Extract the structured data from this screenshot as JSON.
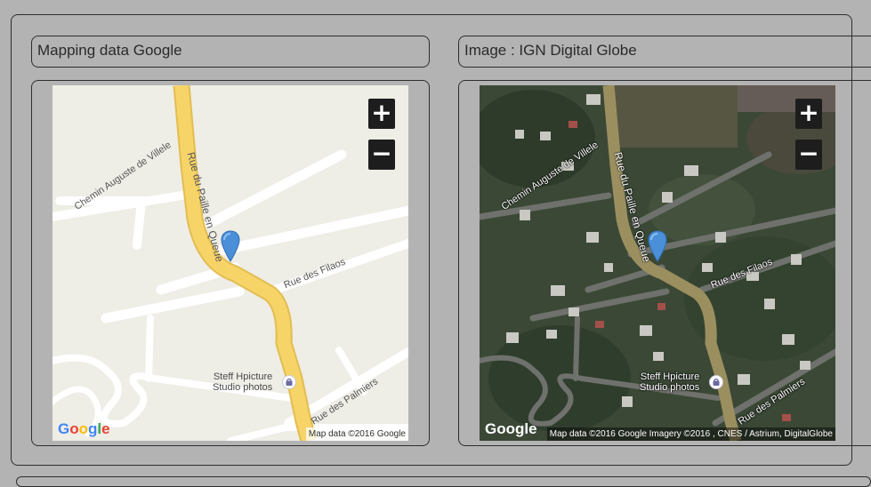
{
  "panels": {
    "left": {
      "title": "Mapping data Google",
      "zoom_in": "+",
      "zoom_out": "−",
      "logo": "Google",
      "credit": "Map data ©2016 Google",
      "tile_style": "roadmap",
      "labels": {
        "road_main": "Rue du Paille en Queue",
        "road_villele": "Chemin Auguste de Villele",
        "road_filaos": "Rue des Filaos",
        "road_palmiers": "Rue des Palmiers",
        "poi_line1": "Steff Hpicture",
        "poi_line2": "Studio photos"
      }
    },
    "right": {
      "title": "Image : IGN Digital Globe",
      "zoom_in": "+",
      "zoom_out": "−",
      "logo": "Google",
      "credit": "Map data ©2016 Google  Imagery ©2016 , CNES / Astrium, DigitalGlobe",
      "tile_style": "satellite",
      "labels": {
        "road_main": "Rue du Paille en Queue",
        "road_villele": "Chemin Auguste de Villele",
        "road_filaos": "Rue des Filaos",
        "road_palmiers": "Rue des Palmiers",
        "poi_line1": "Steff Hpicture",
        "poi_line2": "Studio photos"
      }
    }
  },
  "colors": {
    "page_bg": "#b3b3b3",
    "border": "#2e2e2e",
    "roadmap_bg": "#eeede6",
    "main_road": "#f7d468",
    "satellite_bg": "#3b4836",
    "marker": "#4a8fd8"
  },
  "icons": {
    "marker": "map-pin-icon",
    "poi": "shopping-bag-icon"
  }
}
